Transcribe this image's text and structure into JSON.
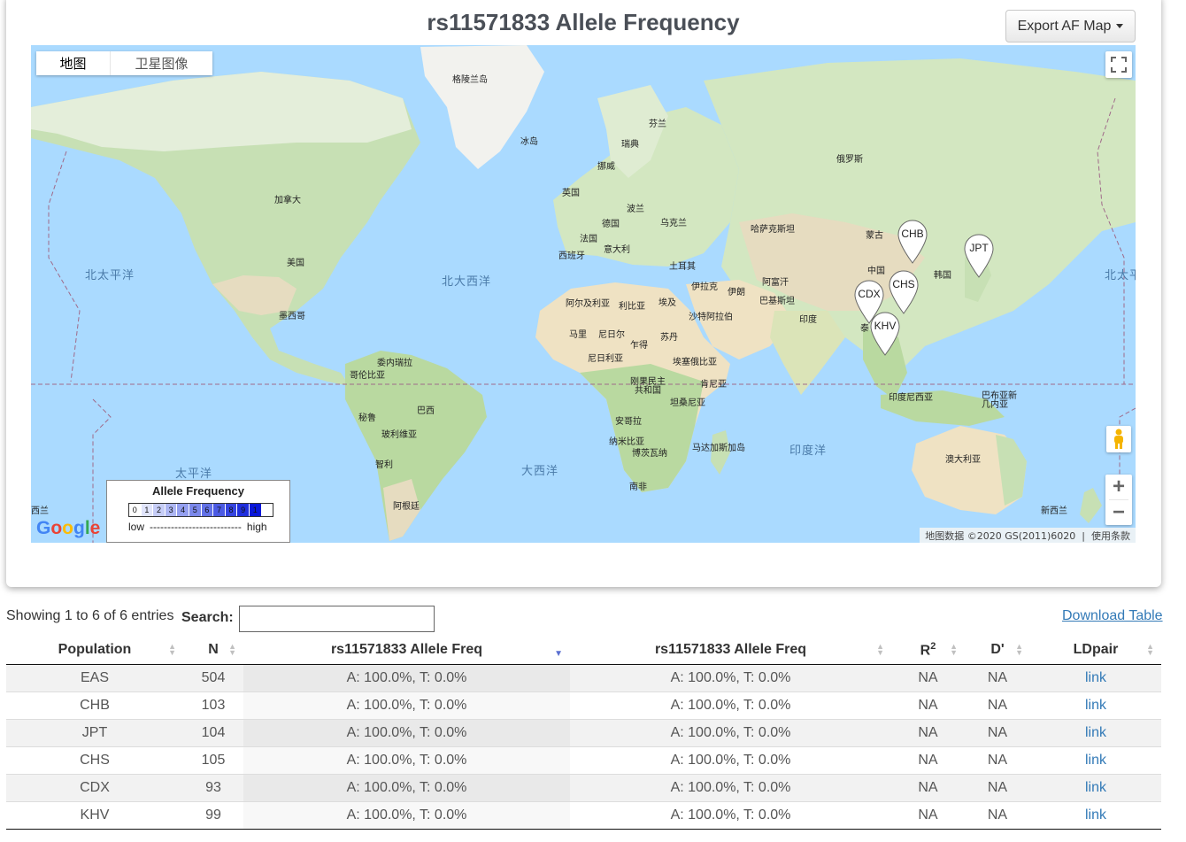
{
  "header": {
    "title": "rs11571833 Allele Frequency",
    "export_label": "Export AF Map"
  },
  "map": {
    "maptype_map": "地图",
    "maptype_satellite": "卫星图像",
    "google_logo": "Google",
    "attribution": "地图数据 ©2020 GS(2011)6020",
    "terms": "使用条款",
    "zoom_in": "+",
    "zoom_out": "−",
    "labels": {
      "greenland": "格陵兰岛",
      "iceland": "冰岛",
      "finland": "芬兰",
      "sweden": "瑞典",
      "norway": "挪威",
      "russia": "俄罗斯",
      "uk": "英国",
      "poland": "波兰",
      "germany": "德国",
      "ukraine": "乌克兰",
      "kazakhstan": "哈萨克斯坦",
      "mongolia": "蒙古",
      "france": "法国",
      "italy": "意大利",
      "spain": "西班牙",
      "turkey": "土耳其",
      "china": "中国",
      "korea": "韩国",
      "iraq": "伊拉克",
      "iran": "伊朗",
      "afghanistan": "阿富汗",
      "pakistan": "巴基斯坦",
      "india": "印度",
      "thailand": "泰",
      "algeria": "阿尔及利亚",
      "libya": "利比亚",
      "egypt": "埃及",
      "saudi": "沙特阿拉伯",
      "mali": "马里",
      "niger": "尼日尔",
      "chad": "乍得",
      "sudan": "苏丹",
      "nigeria": "尼日利亚",
      "ethiopia": "埃塞俄比亚",
      "drc": "刚果民主\n共和国",
      "kenya": "肯尼亚",
      "tanzania": "坦桑尼亚",
      "angola": "安哥拉",
      "namibia": "纳米比亚",
      "botswana": "博茨瓦纳",
      "madagascar": "马达加斯加岛",
      "south_africa": "南非",
      "indonesia": "印度尼西亚",
      "png": "巴布亚新\n几内亚",
      "australia": "澳大利亚",
      "nz": "新西兰",
      "nz_left": "西兰",
      "canada": "加拿大",
      "usa": "美国",
      "mexico": "墨西哥",
      "venezuela": "委内瑞拉",
      "colombia": "哥伦比亚",
      "brazil": "巴西",
      "peru": "秘鲁",
      "bolivia": "玻利维亚",
      "chile": "智利",
      "argentina": "阿根廷"
    },
    "oceans": {
      "north_pacific_left": "北太平洋",
      "north_atlantic": "北大西洋",
      "north_pacific_right": "北太平",
      "pacific": "太平洋",
      "atlantic": "大西洋",
      "indian": "印度洋"
    },
    "pins": [
      "CHB",
      "JPT",
      "CHS",
      "CDX",
      "KHV"
    ]
  },
  "legend": {
    "title": "Allele Frequency",
    "scale": [
      "0",
      "1",
      "2",
      "3",
      "4",
      "5",
      "6",
      "7",
      "8",
      "9",
      "1"
    ],
    "scale_colors": [
      "#ffffff",
      "#e0e4fb",
      "#c6cdf7",
      "#adb6f3",
      "#949fef",
      "#7b88eb",
      "#6271e7",
      "#4b5ae3",
      "#3544e0",
      "#1f2edd",
      "#0a18d9"
    ],
    "low": "low",
    "dashes": "--------------------------",
    "high": "high"
  },
  "controls": {
    "showing": "Showing 1 to 6 of 6 entries",
    "search_label": "Search:",
    "search_value": "",
    "download": "Download Table"
  },
  "table": {
    "headers": {
      "population": "Population",
      "n": "N",
      "freq1": "rs11571833 Allele Freq",
      "freq2": "rs11571833 Allele Freq",
      "r2_base": "R",
      "r2_sup": "2",
      "dprime": "D'",
      "ldpair": "LDpair"
    },
    "rows": [
      {
        "population": "EAS",
        "n": "504",
        "freq1": "A: 100.0%, T: 0.0%",
        "freq2": "A: 100.0%, T: 0.0%",
        "r2": "NA",
        "dprime": "NA",
        "ldpair": "link"
      },
      {
        "population": "CHB",
        "n": "103",
        "freq1": "A: 100.0%, T: 0.0%",
        "freq2": "A: 100.0%, T: 0.0%",
        "r2": "NA",
        "dprime": "NA",
        "ldpair": "link"
      },
      {
        "population": "JPT",
        "n": "104",
        "freq1": "A: 100.0%, T: 0.0%",
        "freq2": "A: 100.0%, T: 0.0%",
        "r2": "NA",
        "dprime": "NA",
        "ldpair": "link"
      },
      {
        "population": "CHS",
        "n": "105",
        "freq1": "A: 100.0%, T: 0.0%",
        "freq2": "A: 100.0%, T: 0.0%",
        "r2": "NA",
        "dprime": "NA",
        "ldpair": "link"
      },
      {
        "population": "CDX",
        "n": "93",
        "freq1": "A: 100.0%, T: 0.0%",
        "freq2": "A: 100.0%, T: 0.0%",
        "r2": "NA",
        "dprime": "NA",
        "ldpair": "link"
      },
      {
        "population": "KHV",
        "n": "99",
        "freq1": "A: 100.0%, T: 0.0%",
        "freq2": "A: 100.0%, T: 0.0%",
        "r2": "NA",
        "dprime": "NA",
        "ldpair": "link"
      }
    ]
  }
}
